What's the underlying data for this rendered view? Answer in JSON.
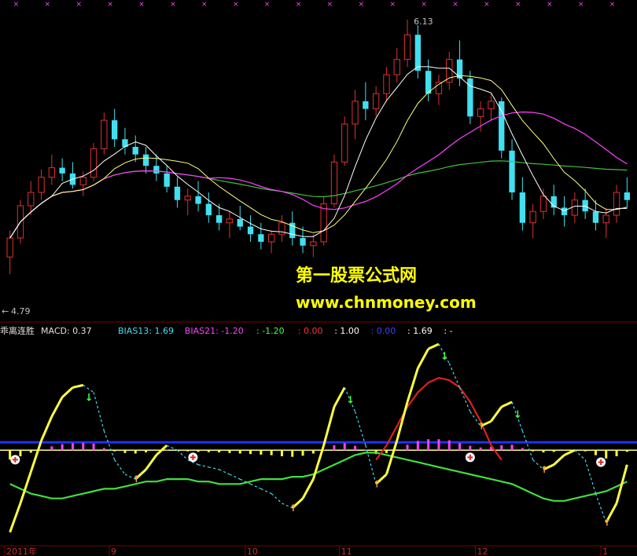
{
  "chart_data": [
    {
      "type": "candlestick",
      "panel": "price",
      "price_high_label": "6.13",
      "price_low_label": "4.79",
      "ylim": [
        4.6,
        6.2
      ],
      "colors": {
        "up": "#e03030",
        "down": "#40e0f0",
        "ma5": "#ffffff",
        "ma10": "#ffff80",
        "ma20": "#ff40ff",
        "ma60": "#40c040"
      },
      "candles": [
        [
          4.88,
          5.02,
          4.79,
          4.98
        ],
        [
          4.98,
          5.18,
          4.95,
          5.15
        ],
        [
          5.15,
          5.28,
          5.1,
          5.22
        ],
        [
          5.22,
          5.34,
          5.18,
          5.3
        ],
        [
          5.3,
          5.42,
          5.26,
          5.35
        ],
        [
          5.35,
          5.4,
          5.28,
          5.32
        ],
        [
          5.32,
          5.38,
          5.24,
          5.26
        ],
        [
          5.26,
          5.33,
          5.2,
          5.3
        ],
        [
          5.3,
          5.48,
          5.28,
          5.45
        ],
        [
          5.45,
          5.64,
          5.42,
          5.6
        ],
        [
          5.6,
          5.66,
          5.46,
          5.5
        ],
        [
          5.5,
          5.56,
          5.42,
          5.46
        ],
        [
          5.46,
          5.52,
          5.38,
          5.42
        ],
        [
          5.42,
          5.46,
          5.32,
          5.36
        ],
        [
          5.36,
          5.42,
          5.28,
          5.32
        ],
        [
          5.32,
          5.36,
          5.22,
          5.25
        ],
        [
          5.25,
          5.3,
          5.14,
          5.18
        ],
        [
          5.18,
          5.24,
          5.1,
          5.2
        ],
        [
          5.2,
          5.28,
          5.12,
          5.16
        ],
        [
          5.16,
          5.22,
          5.06,
          5.1
        ],
        [
          5.1,
          5.16,
          5.02,
          5.06
        ],
        [
          5.06,
          5.12,
          4.98,
          5.08
        ],
        [
          5.08,
          5.15,
          5.02,
          5.04
        ],
        [
          5.04,
          5.1,
          4.96,
          5.0
        ],
        [
          5.0,
          5.06,
          4.92,
          4.96
        ],
        [
          4.96,
          5.02,
          4.9,
          5.0
        ],
        [
          5.0,
          5.1,
          4.96,
          5.06
        ],
        [
          5.06,
          5.12,
          4.94,
          4.98
        ],
        [
          4.98,
          5.04,
          4.9,
          4.94
        ],
        [
          4.94,
          5.0,
          4.88,
          4.96
        ],
        [
          4.96,
          5.2,
          4.94,
          5.16
        ],
        [
          5.16,
          5.42,
          5.14,
          5.38
        ],
        [
          5.38,
          5.62,
          5.36,
          5.58
        ],
        [
          5.58,
          5.76,
          5.5,
          5.7
        ],
        [
          5.7,
          5.8,
          5.6,
          5.66
        ],
        [
          5.66,
          5.78,
          5.62,
          5.74
        ],
        [
          5.74,
          5.88,
          5.7,
          5.84
        ],
        [
          5.84,
          5.98,
          5.8,
          5.92
        ],
        [
          5.92,
          6.13,
          5.88,
          6.05
        ],
        [
          6.05,
          6.1,
          5.82,
          5.86
        ],
        [
          5.86,
          5.92,
          5.7,
          5.74
        ],
        [
          5.74,
          5.84,
          5.68,
          5.8
        ],
        [
          5.8,
          5.96,
          5.76,
          5.92
        ],
        [
          5.92,
          6.02,
          5.78,
          5.82
        ],
        [
          5.82,
          5.86,
          5.58,
          5.62
        ],
        [
          5.62,
          5.7,
          5.54,
          5.66
        ],
        [
          5.66,
          5.74,
          5.6,
          5.7
        ],
        [
          5.7,
          5.72,
          5.4,
          5.44
        ],
        [
          5.44,
          5.5,
          5.18,
          5.22
        ],
        [
          5.22,
          5.3,
          5.02,
          5.06
        ],
        [
          5.06,
          5.16,
          4.98,
          5.12
        ],
        [
          5.12,
          5.24,
          5.08,
          5.2
        ],
        [
          5.2,
          5.26,
          5.1,
          5.14
        ],
        [
          5.14,
          5.2,
          5.04,
          5.1
        ],
        [
          5.1,
          5.22,
          5.06,
          5.18
        ],
        [
          5.18,
          5.24,
          5.08,
          5.12
        ],
        [
          5.12,
          5.18,
          5.02,
          5.06
        ],
        [
          5.06,
          5.14,
          4.98,
          5.1
        ],
        [
          5.1,
          5.26,
          5.06,
          5.22
        ],
        [
          5.22,
          5.3,
          5.14,
          5.18
        ]
      ]
    },
    {
      "type": "line",
      "panel": "indicator",
      "title": "乖离连胜",
      "macd_label": "MACD: 0.37",
      "legend": [
        {
          "text": "BIAS13: 1.69",
          "color": "#40e0f0"
        },
        {
          "text": "BIAS21: -1.20",
          "color": "#ff40ff"
        },
        {
          "text": ": -1.20",
          "color": "#40ff40"
        },
        {
          "text": ": 0.00",
          "color": "#ff3030"
        },
        {
          "text": ": 1.00",
          "color": "#ffffff"
        },
        {
          "text": ": 0.00",
          "color": "#4040ff"
        },
        {
          "text": ": 1.69",
          "color": "#ffffff"
        },
        {
          "text": ": -",
          "color": "#ffffff"
        }
      ],
      "yellow_series": [
        -30,
        -18,
        -5,
        8,
        18,
        26,
        30,
        31,
        28,
        12,
        0,
        -6,
        -8,
        -4,
        2,
        6,
        4,
        0,
        -2,
        -3,
        -4,
        -6,
        -8,
        -10,
        -12,
        -14,
        -18,
        -20,
        -16,
        -8,
        6,
        22,
        30,
        20,
        6,
        -10,
        -6,
        8,
        24,
        38,
        46,
        48,
        40,
        30,
        20,
        14,
        16,
        22,
        24,
        12,
        0,
        -4,
        -2,
        2,
        4,
        0,
        -14,
        -26,
        -18,
        -2
      ],
      "green_series": [
        -10,
        -12,
        -14,
        -15,
        -16,
        -16,
        -15,
        -14,
        -13,
        -12,
        -12,
        -11,
        -10,
        -9,
        -9,
        -8,
        -8,
        -8,
        -9,
        -9,
        -10,
        -10,
        -10,
        -9,
        -8,
        -8,
        -8,
        -7,
        -7,
        -6,
        -4,
        -2,
        0,
        2,
        3,
        3,
        2,
        1,
        0,
        -1,
        -2,
        -3,
        -4,
        -5,
        -6,
        -7,
        -8,
        -9,
        -10,
        -12,
        -14,
        -16,
        -17,
        -17,
        -16,
        -15,
        -14,
        -13,
        -11,
        -9
      ],
      "red_series": [
        null,
        null,
        null,
        null,
        null,
        null,
        null,
        null,
        null,
        null,
        null,
        null,
        null,
        null,
        null,
        null,
        null,
        null,
        null,
        null,
        null,
        null,
        null,
        null,
        null,
        null,
        null,
        null,
        null,
        null,
        null,
        null,
        null,
        null,
        null,
        0,
        6,
        14,
        22,
        28,
        32,
        34,
        33,
        30,
        24,
        16,
        6,
        0,
        null,
        null,
        null,
        null,
        null,
        null,
        null,
        null,
        null,
        null,
        null,
        null
      ],
      "blue_level": 4,
      "ylim": [
        -34,
        50
      ]
    }
  ],
  "x_axis": {
    "labels": [
      "2011年",
      "9",
      "10",
      "11",
      "12",
      "1"
    ],
    "positions_index": [
      0,
      10,
      23,
      32,
      45,
      57
    ]
  },
  "watermark": {
    "line1": "第一股票公式网",
    "line2": "www.chnmoney.com"
  }
}
